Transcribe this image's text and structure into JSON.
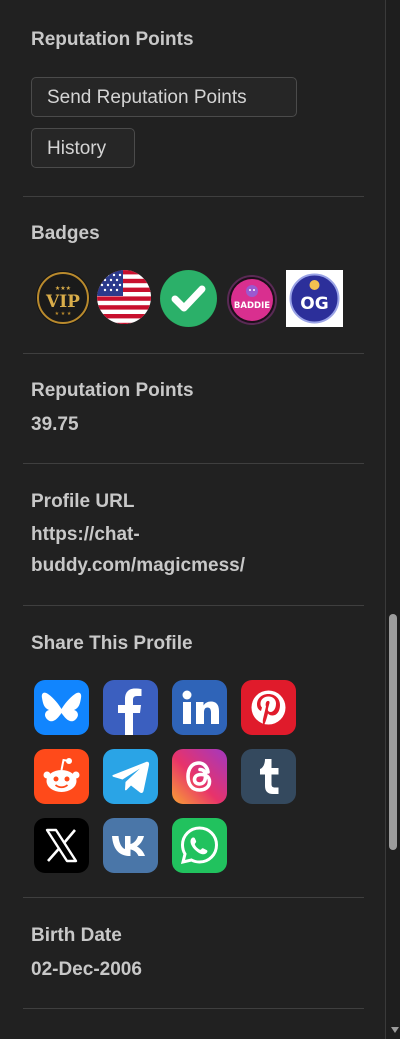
{
  "reputation_actions": {
    "heading": "Reputation Points",
    "send_label": "Send Reputation Points",
    "history_label": "History"
  },
  "badges": {
    "heading": "Badges",
    "items": [
      {
        "name": "vip-badge-icon",
        "text": "VIP"
      },
      {
        "name": "us-flag-badge-icon",
        "text": ""
      },
      {
        "name": "verified-check-badge-icon",
        "text": ""
      },
      {
        "name": "baddie-badge-icon",
        "text": "BADDIE"
      },
      {
        "name": "og-badge-icon",
        "text": "OG"
      }
    ]
  },
  "reputation_points": {
    "heading": "Reputation Points",
    "value": "39.75"
  },
  "profile_url": {
    "heading": "Profile URL",
    "line1": "https://chat-",
    "line2": "buddy.com/magicmess/"
  },
  "share": {
    "heading": "Share This Profile",
    "icons": [
      {
        "name": "bluesky-icon",
        "color": "#1185fe"
      },
      {
        "name": "facebook-icon",
        "color": "#1877f2"
      },
      {
        "name": "linkedin-icon",
        "color": "#0a66c2"
      },
      {
        "name": "pinterest-icon",
        "color": "#e60023"
      },
      {
        "name": "reddit-icon",
        "color": "#ff4500"
      },
      {
        "name": "telegram-icon",
        "color": "#29a9eb"
      },
      {
        "name": "threads-icon",
        "color": "#c13584"
      },
      {
        "name": "tumblr-icon",
        "color": "#35465c"
      },
      {
        "name": "x-icon",
        "color": "#000000"
      },
      {
        "name": "vk-icon",
        "color": "#4a76a8"
      },
      {
        "name": "whatsapp-icon",
        "color": "#25d366"
      }
    ]
  },
  "birth_date": {
    "heading": "Birth Date",
    "value": "02-Dec-2006"
  }
}
